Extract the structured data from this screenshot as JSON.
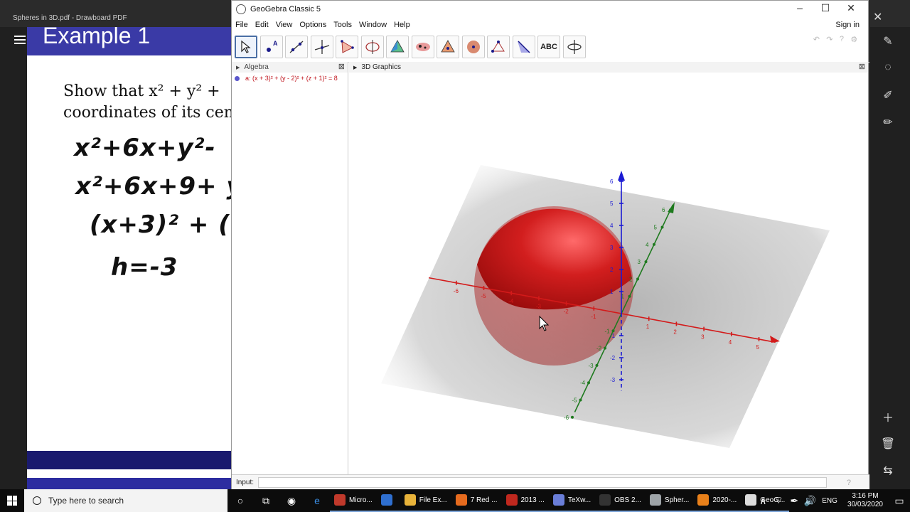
{
  "drawboard": {
    "window_title": "Spheres in 3D.pdf - Drawboard PDF",
    "page": {
      "heading": "Example 1",
      "problem_line1": "Show that x² + y² + ",
      "problem_line2": "coordinates of its cen",
      "handwriting": [
        "x²+6x+y²-",
        "x²+6x+9+ y",
        "(x+3)² + (",
        "h=-3"
      ]
    }
  },
  "geogebra": {
    "title": "GeoGebra Classic 5",
    "window_controls": [
      "–",
      "☐",
      "✕"
    ],
    "menu": [
      "File",
      "Edit",
      "View",
      "Options",
      "Tools",
      "Window",
      "Help"
    ],
    "sign_in": "Sign in",
    "toolbar": [
      "move-tool",
      "point-tool",
      "line-tool",
      "perpendicular-tool",
      "polygon-tool",
      "circle-tool",
      "pyramid-tool",
      "sphere-tool",
      "plane-tool",
      "intersect-tool",
      "rotate-tool",
      "reflect-tool",
      "ABC",
      "rotate-view-tool"
    ],
    "text_tool_label": "ABC",
    "algebra": {
      "header": "Algebra",
      "object": "a: (x + 3)² + (y - 2)² + (z + 1)² = 8"
    },
    "graphics3d": {
      "header": "3D Graphics",
      "colors": {
        "x_axis": "#d31a1a",
        "y_axis": "#1e7a1e",
        "z_axis": "#1a1ad3",
        "sphere": "#c81414"
      },
      "x_ticks": [
        "-6",
        "-5",
        "-4",
        "-3",
        "-2",
        "-1",
        "0",
        "1",
        "2",
        "3",
        "4",
        "5"
      ],
      "y_ticks": [
        "-6",
        "-5",
        "-4",
        "-3",
        "-2",
        "-1",
        "1",
        "2",
        "3",
        "4",
        "5",
        "6"
      ],
      "z_ticks": [
        "-3",
        "-2",
        "-1",
        "1",
        "2",
        "3",
        "4",
        "5",
        "6"
      ]
    },
    "input_label": "Input:"
  },
  "taskbar": {
    "search_placeholder": "Type here to search",
    "apps": [
      {
        "label": "Micro...",
        "color": "#c0392b"
      },
      {
        "label": "",
        "color": "#2f6fcf"
      },
      {
        "label": "File Ex...",
        "color": "#e8b33a"
      },
      {
        "label": "7 Red ...",
        "color": "#e66b1e"
      },
      {
        "label": "2013 ...",
        "color": "#c0281e"
      },
      {
        "label": "TeXw...",
        "color": "#6a7ed8"
      },
      {
        "label": "OBS 2...",
        "color": "#333333"
      },
      {
        "label": "Spher...",
        "color": "#9ea4a8"
      },
      {
        "label": "2020-...",
        "color": "#e8801a"
      },
      {
        "label": "GeoG...",
        "color": "#dddddd"
      }
    ],
    "language": "ENG",
    "time": "3:16 PM",
    "date": "30/03/2020"
  }
}
